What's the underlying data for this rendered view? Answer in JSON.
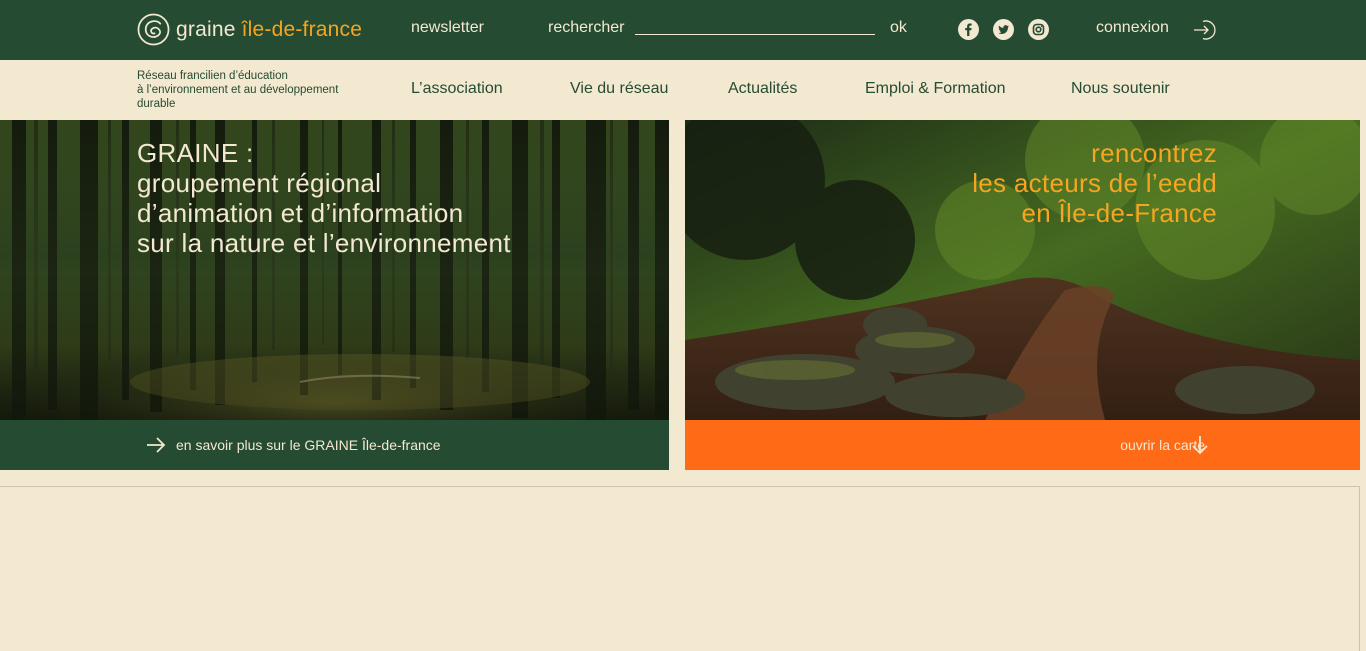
{
  "brand": {
    "name_part1": "graine",
    "name_part2": "île-de-france"
  },
  "topbar": {
    "newsletter": "newsletter",
    "search_label": "rechercher",
    "search_value": "",
    "search_submit": "ok",
    "social_icons": [
      "facebook-icon",
      "twitter-icon",
      "instagram-icon"
    ],
    "login": "connexion"
  },
  "subnav": {
    "tagline_line1": "Réseau francilien d’éducation",
    "tagline_line2": "à l’environnement et au développement",
    "tagline_line3": "durable",
    "items": [
      {
        "label": "L’association"
      },
      {
        "label": "Vie du réseau"
      },
      {
        "label": "Actualités"
      },
      {
        "label": "Emploi & Formation"
      },
      {
        "label": "Nous soutenir"
      }
    ]
  },
  "hero_left": {
    "line1": "GRAINE :",
    "line2": "groupement régional",
    "line3": "d’animation et d’information",
    "line4": "sur la nature et l’environnement",
    "cta": "en savoir plus sur le GRAINE Île-de-france"
  },
  "hero_right": {
    "line1": "rencontrez",
    "line2": "les acteurs de l’eedd",
    "line3": "en Île-de-France",
    "cta": "ouvrir la carte"
  },
  "colors": {
    "dark_green": "#254b32",
    "cream": "#f3e8d0",
    "orange_text": "#f6a520",
    "orange_cta": "#ff6a17"
  }
}
